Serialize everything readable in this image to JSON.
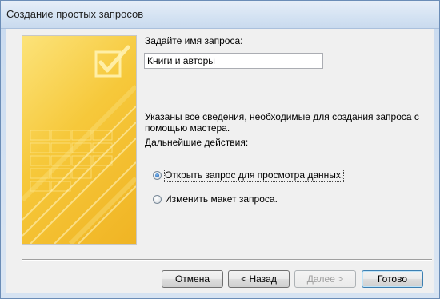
{
  "window": {
    "title": "Создание простых запросов"
  },
  "form": {
    "name_prompt": "Задайте имя запроса:",
    "name_value": "Книги и авторы",
    "info_line1": "Указаны все сведения, необходимые для создания запроса с",
    "info_line2": "помощью мастера.",
    "next_actions": "Дальнейшие действия:",
    "options": [
      {
        "label": "Открыть запрос для просмотра данных.",
        "selected": true
      },
      {
        "label": "Изменить макет запроса.",
        "selected": false
      }
    ]
  },
  "buttons": {
    "cancel": "Отмена",
    "back": "< Назад",
    "next": "Далее >",
    "finish": "Готово"
  },
  "colors": {
    "art_light": "#fce37a",
    "art_dark": "#f0b424",
    "default_button_border": "#3c7fb1"
  }
}
